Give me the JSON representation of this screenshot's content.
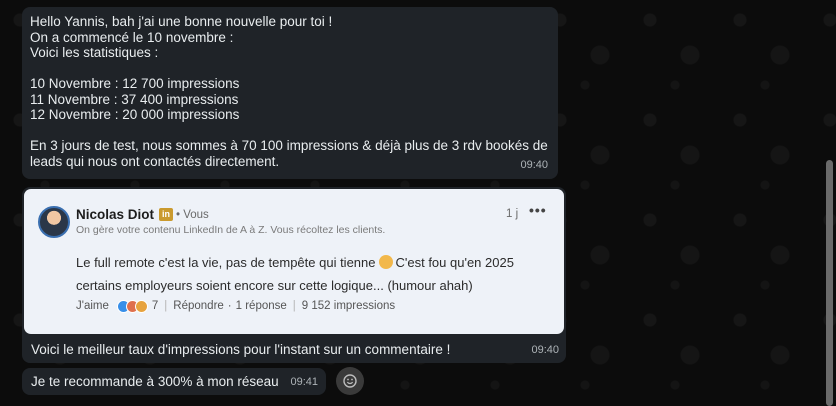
{
  "messages": [
    {
      "lines": [
        "Hello Yannis, bah j'ai une bonne nouvelle pour toi !",
        "On a commencé le 10 novembre :",
        "Voici les statistiques :",
        "",
        "10 Novembre : 12 700 impressions",
        "11 Novembre : 37 400 impressions",
        "12 Novembre : 20 000 impressions",
        "",
        "En 3 jours de test, nous sommes à 70 100 impressions & déjà plus de 3 rdv bookés de",
        "leads qui nous ont contactés directement."
      ],
      "time": "09:40"
    },
    {
      "card": {
        "author": "Nicolas Diot",
        "badge": "in",
        "relation": "• Vous",
        "headline": "On gère votre contenu LinkedIn de A à Z. Vous récoltez les clients.",
        "age": "1 j",
        "menu": "•••",
        "comment_line1_a": "Le full remote c'est la vie, pas de tempête qui tienne",
        "comment_line1_b": "C'est fou qu'en 2025",
        "comment_line2": "certains employeurs soient encore sur cette logique... (humour ahah)",
        "like_label": "J'aime",
        "reaction_count": "7",
        "reply_label": "Répondre",
        "reply_count": "1 réponse",
        "impressions": "9 152 impressions",
        "reaction_colors": [
          "#378fe9",
          "#df704d",
          "#e7a33e"
        ]
      },
      "caption": "Voici le meilleur taux d'impressions pour l'instant sur un commentaire !",
      "time": "09:40"
    },
    {
      "caption": "Je te recommande à 300% à mon réseau",
      "time": "09:41"
    }
  ],
  "colors": {
    "bubble": "#1f2328",
    "card": "#eef2f8",
    "linkedin_badge": "#ca9a2e"
  }
}
